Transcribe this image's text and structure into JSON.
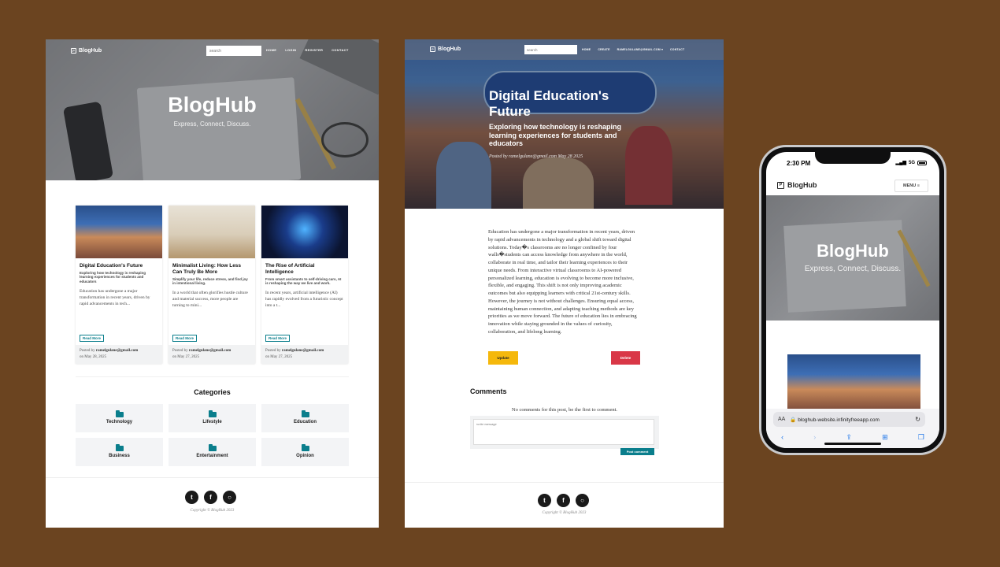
{
  "home": {
    "brand": "BlogHub",
    "search_placeholder": "search",
    "nav_links": [
      "HOME",
      "LOGIN",
      "REGISTER",
      "CONTACT"
    ],
    "hero_title": "BlogHub",
    "hero_subtitle": "Express, Connect, Discuss.",
    "cards": [
      {
        "title": "Digital Education's Future",
        "subtitle": "Exploring how technology is reshaping learning experiences for students and educators",
        "excerpt": "Education has undergone a major transformation in recent years, driven by rapid advancements in tech...",
        "read_more": "Read More",
        "posted_by": "Posted by",
        "author": "ramelgulane@gmail.com",
        "date": "on May 28, 2025"
      },
      {
        "title": "Minimalist Living: How Less Can Truly Be More",
        "subtitle": "Simplify your life, reduce stress, and find joy in intentional living.",
        "excerpt": "In a world that often glorifies hustle culture and material success, more people are turning to mini...",
        "read_more": "Read More",
        "posted_by": "Posted by",
        "author": "ramelgulane@gmail.com",
        "date": "on May 27, 2025"
      },
      {
        "title": "The Rise of Artificial Intelligence",
        "subtitle": "From smart assistants to self-driving cars, AI is reshaping the way we live and work.",
        "excerpt": "In recent years, artificial intelligence (AI) has rapidly evolved from a futuristic concept into a t...",
        "read_more": "Read More",
        "posted_by": "Posted by",
        "author": "ramelgulane@gmail.com",
        "date": "on May 27, 2025"
      }
    ],
    "categories_title": "Categories",
    "categories": [
      "Technology",
      "Lifestyle",
      "Education",
      "Business",
      "Entertainment",
      "Opinion"
    ],
    "copyright": "Copyright © BlogHub 2023"
  },
  "post": {
    "brand": "BlogHub",
    "search_placeholder": "search",
    "nav_links": [
      "HOME",
      "CREATE",
      "RAMELGULANE@GMAIL.COM ▾",
      "CONTACT"
    ],
    "title": "Digital Education's Future",
    "subtitle": "Exploring how technology is reshaping learning experiences for students and educators",
    "meta": "Posted by ramelgulane@gmail.com May 28 2025",
    "body": "Education has undergone a major transformation in recent years, driven by rapid advancements in technology and a global shift toward digital solutions. Today�s classrooms are no longer confined by four walls�students can access knowledge from anywhere in the world, collaborate in real time, and tailor their learning experiences to their unique needs. From interactive virtual classrooms to AI-powered personalized learning, education is evolving to become more inclusive, flexible, and engaging. This shift is not only improving academic outcomes but also equipping learners with critical 21st-century skills. However, the journey is not without challenges. Ensuring equal access, maintaining human connection, and adapting teaching methods are key priorities as we move forward. The future of education lies in embracing innovation while staying grounded in the values of curiosity, collaboration, and lifelong learning.",
    "update_label": "Update",
    "delete_label": "Delete",
    "comments_title": "Comments",
    "no_comments": "No comments for this post, be the first to comment.",
    "comment_placeholder": "write message",
    "post_comment_label": "Post comment",
    "copyright": "Copyright © BlogHub 2023"
  },
  "mobile": {
    "time": "2:30 PM",
    "network": "5G",
    "brand": "BlogHub",
    "menu_label": "MENU ≡",
    "hero_title": "BlogHub",
    "hero_subtitle": "Express, Connect, Discuss.",
    "aa_label": "AA",
    "url": "🔒 bloghub-website.infinityfreeapp.com"
  },
  "icons": {
    "social": [
      "twitter-icon",
      "facebook-icon",
      "github-icon"
    ],
    "category": "folder-icon",
    "browser": [
      "back-icon",
      "forward-icon",
      "share-icon",
      "bookmarks-icon",
      "tabs-icon"
    ]
  },
  "colors": {
    "background": "#6b4420",
    "accent": "#0a7e8c",
    "update": "#f5b80c",
    "delete": "#d93747"
  }
}
